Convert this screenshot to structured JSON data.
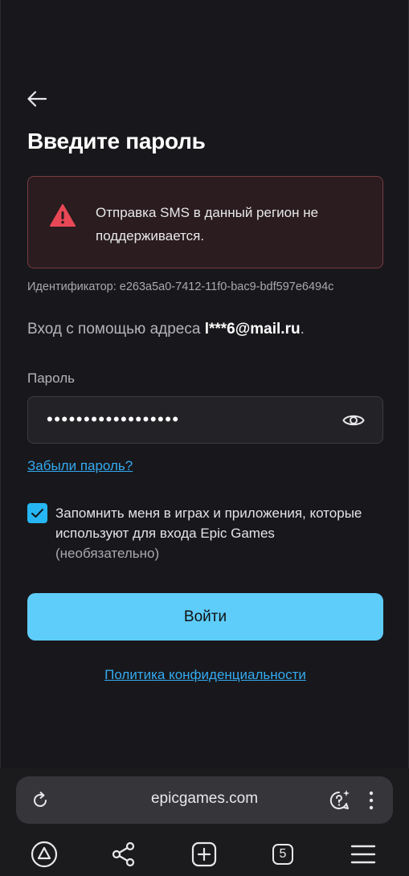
{
  "page": {
    "title": "Введите пароль",
    "alert_message": "Отправка SMS в данный регион не поддерживается.",
    "identifier": "Идентификатор: e263a5a0-7412-11f0-bac9-bdf597e6494c",
    "login_prefix": "Вход с помощью адреса ",
    "login_email": "l***6@mail.ru",
    "login_suffix": ".",
    "password_label": "Пароль",
    "password_value": "••••••••••••••••••",
    "forgot_link": "Забыли пароль?",
    "remember_checked": true,
    "remember_text": "Запомнить меня в играх и приложения, которые используют для входа Epic Games",
    "remember_optional": "(необязательно)",
    "submit_label": "Войти",
    "privacy_link": "Политика конфиденциальности"
  },
  "browser": {
    "url": "epicgames.com",
    "tab_count": "5"
  },
  "colors": {
    "background": "#18181c",
    "accent": "#5ecdfa",
    "link": "#34aaf0",
    "alert_bg": "#2a1c1f",
    "alert_border": "#7a3a44",
    "warning_icon": "#e84855"
  },
  "icons": [
    "back-arrow-icon",
    "warning-icon",
    "eye-icon",
    "check-icon",
    "reload-icon",
    "ai-assistant-icon",
    "more-vertical-icon",
    "alice-icon",
    "share-icon",
    "new-tab-icon",
    "tabs-icon",
    "menu-icon"
  ]
}
